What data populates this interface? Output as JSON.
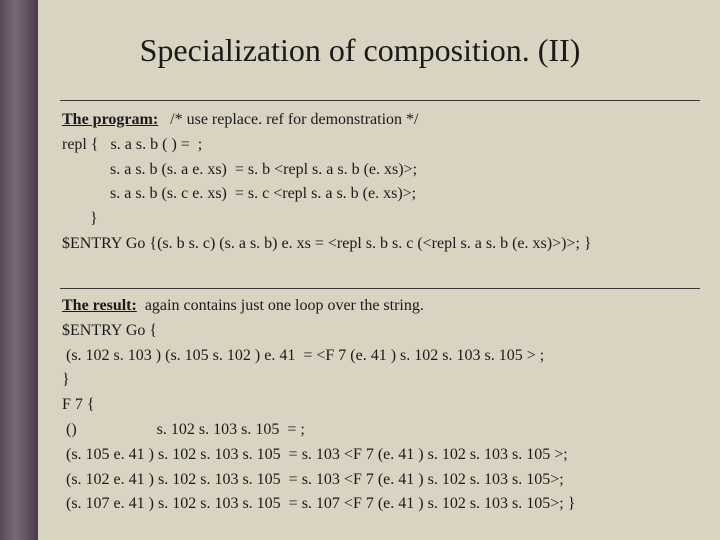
{
  "title": "Specialization of composition. (II)",
  "program": {
    "heading": "The program:",
    "comment": "/* use replace. ref for demonstration */",
    "lines": [
      "repl {   s. a s. b ( ) =  ;",
      "            s. a s. b (s. a e. xs)  = s. b <repl s. a s. b (e. xs)>;",
      "            s. a s. b (s. c e. xs)  = s. c <repl s. a s. b (e. xs)>;",
      "       }",
      "$ENTRY Go {(s. b s. c) (s. a s. b) e. xs = <repl s. b s. c (<repl s. a s. b (e. xs)>)>; }"
    ]
  },
  "result": {
    "heading": "The result:",
    "comment": "again contains just one loop over the string.",
    "lines": [
      "$ENTRY Go {",
      " (s. 102 s. 103 ) (s. 105 s. 102 ) e. 41  = <F 7 (e. 41 ) s. 102 s. 103 s. 105 > ;",
      "}",
      "F 7 {",
      " ()                    s. 102 s. 103 s. 105  = ;",
      " (s. 105 e. 41 ) s. 102 s. 103 s. 105  = s. 103 <F 7 (e. 41 ) s. 102 s. 103 s. 105 >;",
      " (s. 102 e. 41 ) s. 102 s. 103 s. 105  = s. 103 <F 7 (e. 41 ) s. 102 s. 103 s. 105>;",
      " (s. 107 e. 41 ) s. 102 s. 103 s. 105  = s. 107 <F 7 (e. 41 ) s. 102 s. 103 s. 105>; }"
    ]
  }
}
